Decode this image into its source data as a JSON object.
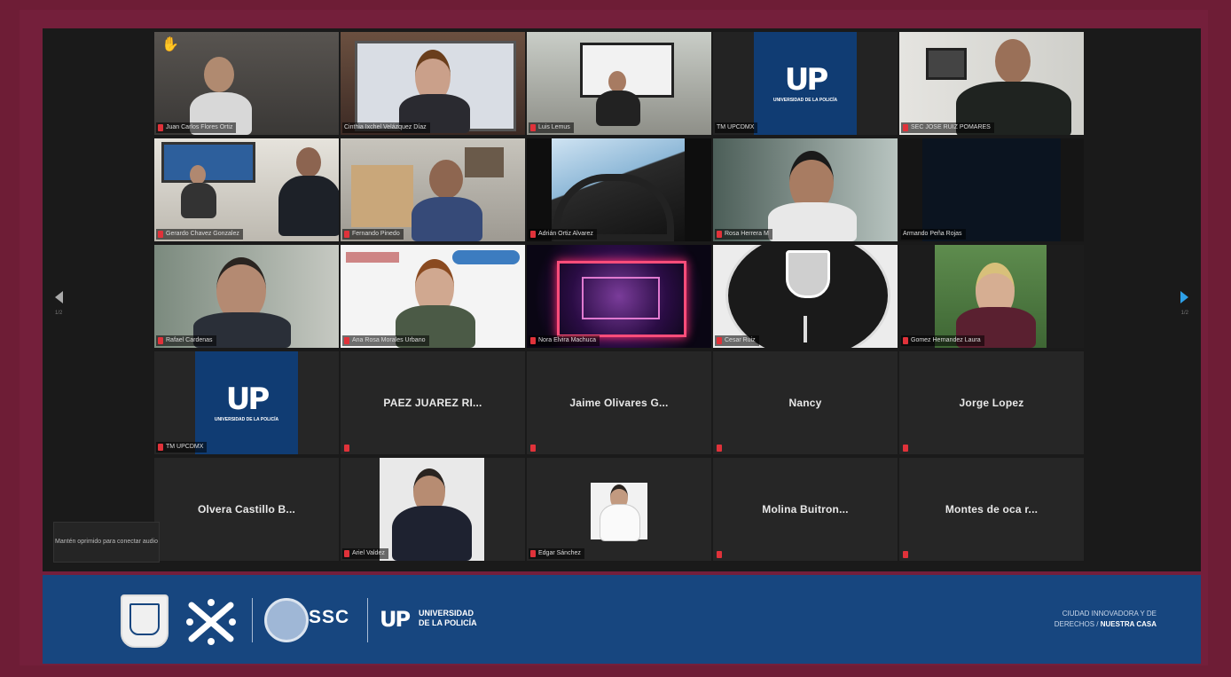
{
  "colors": {
    "frame": "#741f3b",
    "screen": "#1a1a1a",
    "banner": "#17467f",
    "active_speaker_border": "#d9cf5a",
    "muted_icon": "#e0323a",
    "next_arrow": "#2ea0e8"
  },
  "nav": {
    "prev_page": "1/2",
    "next_page": "1/2"
  },
  "tooltip": {
    "text": "Mantén oprimido para conectar audio"
  },
  "participants": [
    {
      "name": "Juan Carlos Flores Ortiz",
      "muted": true,
      "kind": "video",
      "raised_hand": true
    },
    {
      "name": "Cinthia Ixchel Velázquez Díaz",
      "muted": false,
      "kind": "video",
      "active_speaker": true
    },
    {
      "name": "Luis Lemus",
      "muted": true,
      "kind": "video"
    },
    {
      "name": "TM UPCDMX",
      "muted": false,
      "kind": "logo"
    },
    {
      "name": "SEC JOSE RUIZ POMARES",
      "muted": true,
      "kind": "video"
    },
    {
      "name": "Gerardo Chavez Gonzalez",
      "muted": true,
      "kind": "video"
    },
    {
      "name": "Fernando Pinedo",
      "muted": true,
      "kind": "video"
    },
    {
      "name": "Adrián Ortiz Alvarez",
      "muted": true,
      "kind": "video"
    },
    {
      "name": "Rosa Herrera M",
      "muted": true,
      "kind": "video"
    },
    {
      "name": "Armando Peña Rojas",
      "muted": false,
      "kind": "video"
    },
    {
      "name": "Rafael Cardenas",
      "muted": true,
      "kind": "video"
    },
    {
      "name": "Ana Rosa Morales Urbano",
      "muted": true,
      "kind": "video"
    },
    {
      "name": "Nora Elvira Machuca",
      "muted": true,
      "kind": "video"
    },
    {
      "name": "Cesar Ruiz",
      "muted": true,
      "kind": "video"
    },
    {
      "name": "Gomez Hernandez Laura",
      "muted": true,
      "kind": "video"
    },
    {
      "name": "TM UPCDMX",
      "muted": true,
      "kind": "logo"
    },
    {
      "name": "PAEZ JUAREZ RI...",
      "muted": true,
      "kind": "text"
    },
    {
      "name": "Jaime Olivares G...",
      "muted": true,
      "kind": "text"
    },
    {
      "name": "Nancy",
      "muted": true,
      "kind": "text"
    },
    {
      "name": "Jorge Lopez",
      "muted": true,
      "kind": "text"
    },
    {
      "name": "Olvera Castillo B...",
      "muted": false,
      "kind": "text"
    },
    {
      "name": "Ariel Valdez",
      "muted": true,
      "kind": "photo"
    },
    {
      "name": "Edgar Sánchez",
      "muted": true,
      "kind": "photo"
    },
    {
      "name": "Molina Buitron...",
      "muted": true,
      "kind": "text"
    },
    {
      "name": "Montes de oca r...",
      "muted": true,
      "kind": "text"
    }
  ],
  "logos": {
    "up_mark": "UP",
    "up_text": "UNIVERSIDAD DE LA POLICÍA",
    "ssc": "SSC",
    "banner_up_line1": "UNIVERSIDAD",
    "banner_up_line2": "DE LA POLICÍA",
    "tagline_line1": "CIUDAD INNOVADORA Y DE",
    "tagline_line2a": "DERECHOS / ",
    "tagline_line2b": "NUESTRA CASA"
  }
}
